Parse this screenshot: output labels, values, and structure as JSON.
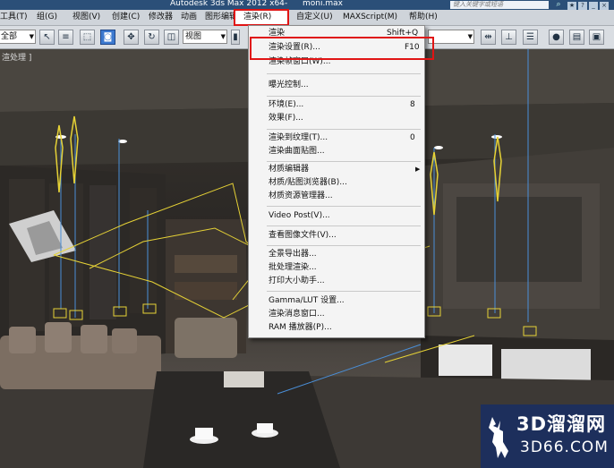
{
  "titlebar": {
    "title": "Autodesk 3ds Max  2012 x64",
    "separator": "-",
    "file": "moni.max",
    "search_placeholder": "键入关键字或短语"
  },
  "menubar": {
    "items": [
      {
        "label": "工具(T)"
      },
      {
        "label": "组(G)"
      },
      {
        "label": "视图(V)"
      },
      {
        "label": "创建(C)"
      },
      {
        "label": "修改器"
      },
      {
        "label": "动画"
      },
      {
        "label": "图形编辑器"
      },
      {
        "label": "渲染(R)"
      },
      {
        "label": "自定义(U)"
      },
      {
        "label": "MAXScript(M)"
      },
      {
        "label": "帮助(H)"
      }
    ]
  },
  "toolbar": {
    "selection_filter": "全部",
    "reference_coord": "视图"
  },
  "viewport": {
    "label": "渲处理 ]"
  },
  "render_menu": {
    "items": [
      {
        "label": "渲染",
        "shortcut": "Shift+Q"
      },
      {
        "label": "渲染设置(R)...",
        "shortcut": "F10"
      },
      {
        "label": "渲染帧窗口(W)...",
        "shortcut": ""
      },
      {
        "label": "曝光控制...",
        "shortcut": ""
      },
      {
        "label": "环境(E)...",
        "shortcut": "8"
      },
      {
        "label": "效果(F)...",
        "shortcut": ""
      },
      {
        "label": "渲染到纹理(T)...",
        "shortcut": "0"
      },
      {
        "label": "渲染曲面贴图...",
        "shortcut": ""
      },
      {
        "label": "材质编辑器",
        "shortcut": ""
      },
      {
        "label": "材质/贴图浏览器(B)...",
        "shortcut": ""
      },
      {
        "label": "材质资源管理器...",
        "shortcut": ""
      },
      {
        "label": "Video Post(V)...",
        "shortcut": ""
      },
      {
        "label": "查看图像文件(V)...",
        "shortcut": ""
      },
      {
        "label": "全景导出器...",
        "shortcut": ""
      },
      {
        "label": "批处理渲染...",
        "shortcut": ""
      },
      {
        "label": "打印大小助手...",
        "shortcut": ""
      },
      {
        "label": "Gamma/LUT 设置...",
        "shortcut": ""
      },
      {
        "label": "渲染消息窗口...",
        "shortcut": ""
      },
      {
        "label": "RAM 播放器(P)...",
        "shortcut": ""
      }
    ]
  },
  "watermark": {
    "brand_cn": "3D溜溜网",
    "brand_domain": "3D66.COM"
  },
  "colors": {
    "highlight_red": "#e01414",
    "title_blue": "#2b4f78",
    "watermark_navy": "#1d2f5c"
  }
}
